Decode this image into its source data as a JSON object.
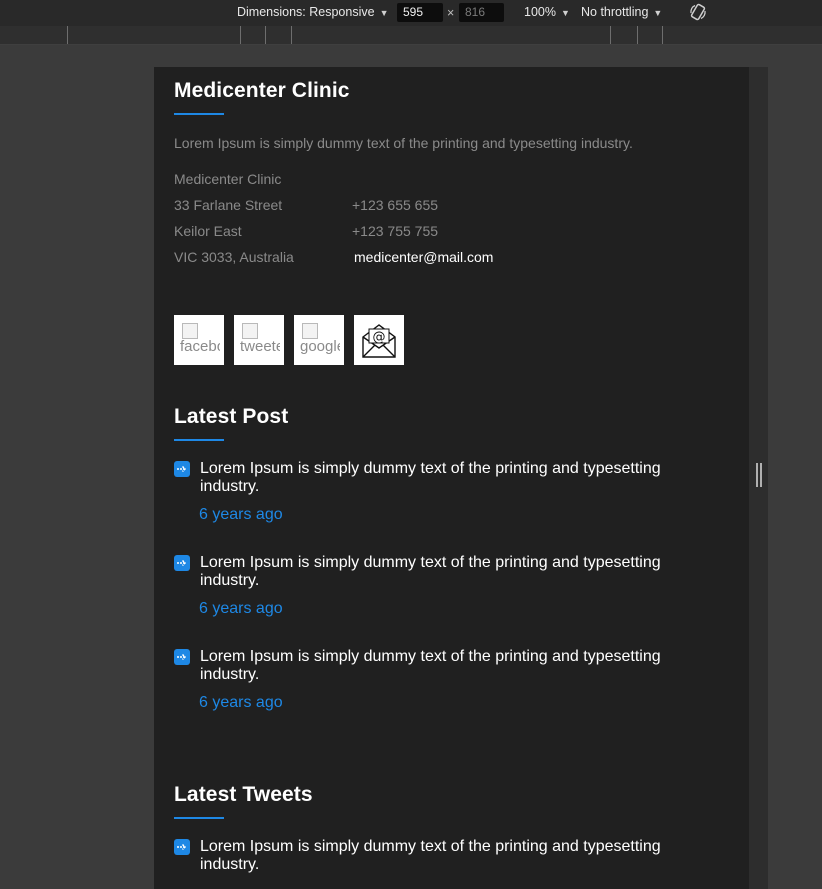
{
  "devtools": {
    "dimensions_label": "Dimensions: Responsive",
    "width_value": "595",
    "times_symbol": "×",
    "height_placeholder": "816",
    "zoom_label": "100%",
    "throttling_label": "No throttling",
    "rotate_icon": "rotate-device-icon"
  },
  "footer": {
    "clinic_title": "Medicenter Clinic",
    "description": "Lorem Ipsum is simply dummy text of the printing and typesetting industry.",
    "address": [
      "Medicenter Clinic",
      "33 Farlane Street",
      "Keilor East",
      "VIC 3033, Australia"
    ],
    "phones": [
      "+123 655 655",
      "+123 755 755"
    ],
    "email": "medicenter@mail.com",
    "social": [
      {
        "alt": "facebook",
        "icon": "facebook-icon"
      },
      {
        "alt": "tweeter",
        "icon": "twitter-icon"
      },
      {
        "alt": "google",
        "icon": "google-icon"
      },
      {
        "icon": "email-envelope-icon"
      }
    ],
    "latest_post_title": "Latest Post",
    "posts": [
      {
        "text": "Lorem Ipsum is simply dummy text of the printing and typesetting industry.",
        "time": "6 years ago"
      },
      {
        "text": "Lorem Ipsum is simply dummy text of the printing and typesetting industry.",
        "time": "6 years ago"
      },
      {
        "text": "Lorem Ipsum is simply dummy text of the printing and typesetting industry.",
        "time": "6 years ago"
      }
    ],
    "latest_tweets_title": "Latest Tweets",
    "tweets": [
      {
        "text": "Lorem Ipsum is simply dummy text of the printing and typesetting industry."
      }
    ]
  },
  "colors": {
    "accent": "#1e88e5",
    "panel": "#202020",
    "muted_text": "#8a8a8a"
  }
}
